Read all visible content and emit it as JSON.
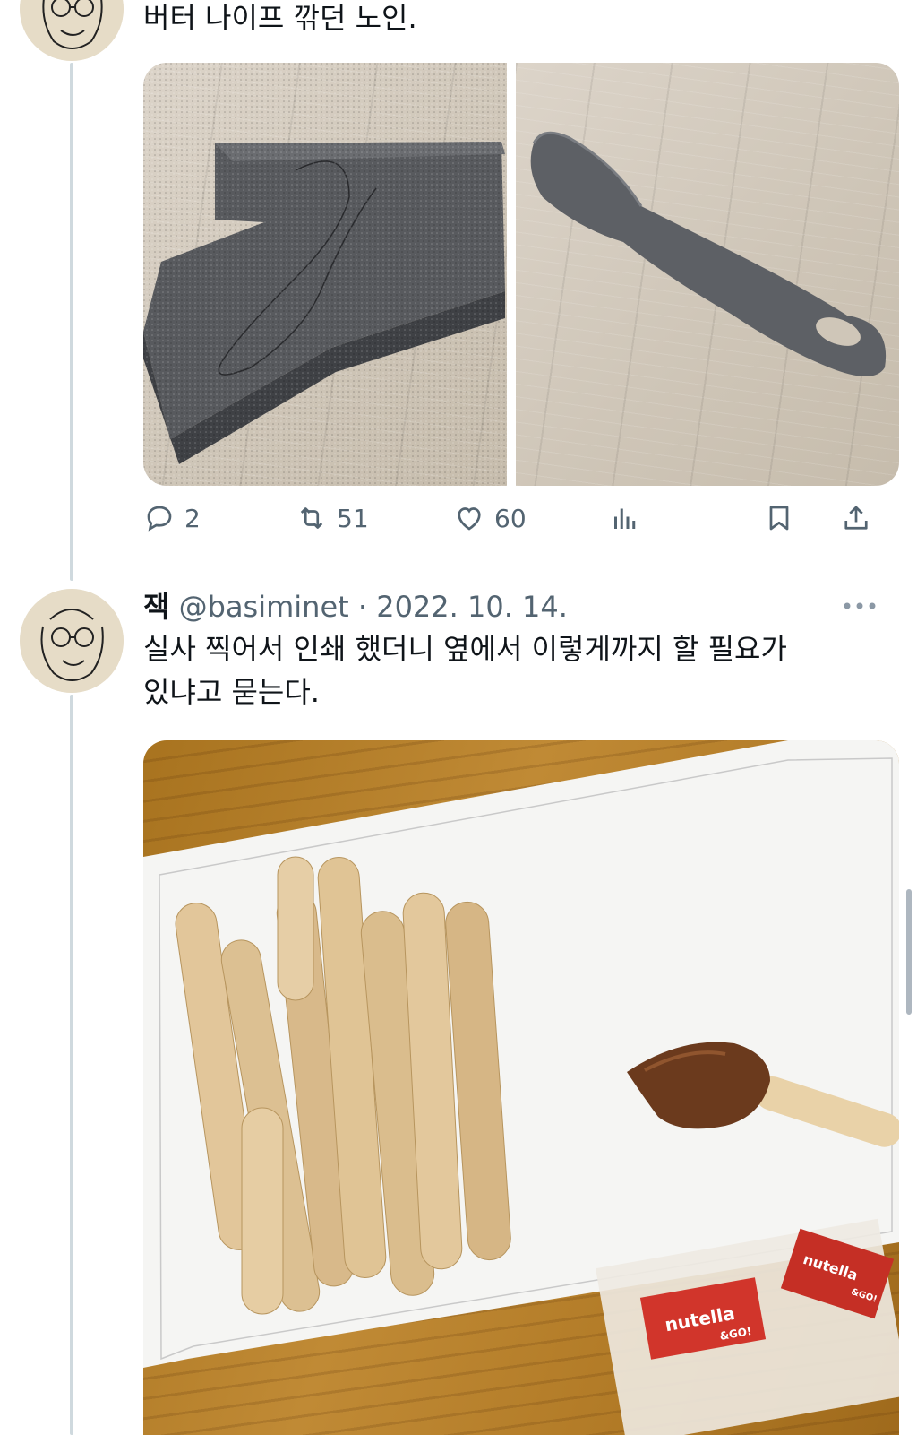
{
  "tweet1": {
    "text_line1": "버터 나이프 깎던 노인.",
    "actions": {
      "replies": "2",
      "retweets": "51",
      "likes": "60"
    }
  },
  "tweet2": {
    "name": "잭",
    "handle": "@basiminet",
    "separator": "·",
    "date": "2022. 10. 14.",
    "text_line1": "실사 찍어서 인쇄 했더니 옆에서 이렇게까지 할 필요가",
    "text_line2": "있냐고 묻는다."
  },
  "photo_labels": {
    "nutella_1": "nutella",
    "nutella_1_sub": "&GO!",
    "nutella_2": "nutella",
    "nutella_2_sub": "&GO!"
  },
  "colors": {
    "text": "#0f1419",
    "secondary": "#536471",
    "thread_line": "#cfd9de"
  },
  "icons": [
    "reply-icon",
    "retweet-icon",
    "like-icon",
    "views-icon",
    "bookmark-icon",
    "share-icon",
    "more-icon"
  ]
}
